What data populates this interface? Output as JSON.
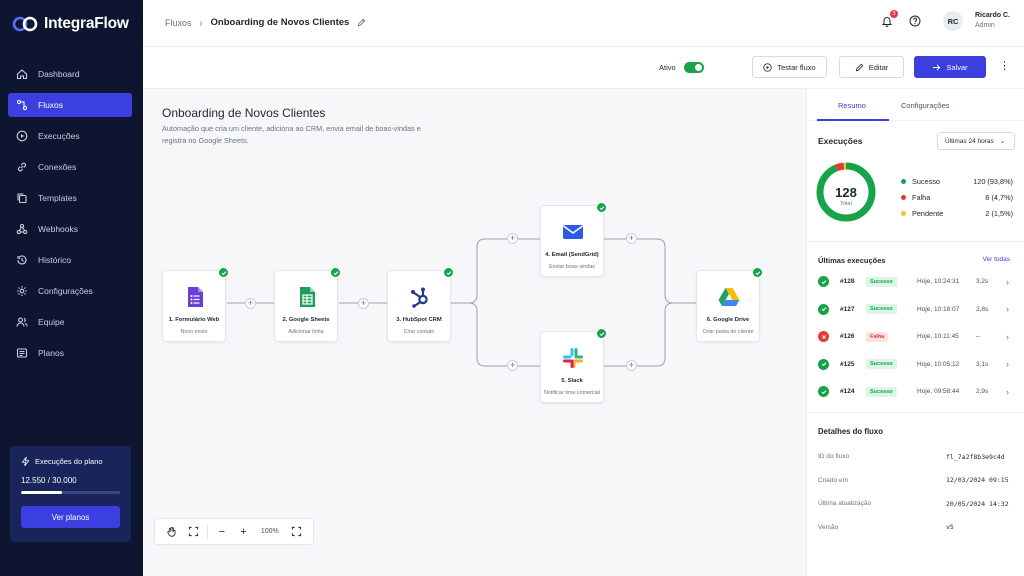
{
  "app": {
    "name": "IntegraFlow",
    "colors": {
      "accent": "#3b3fe0",
      "sidebar": "#0d1530",
      "success": "#16a34a",
      "failure": "#e23b3b",
      "pending": "#f2c230"
    }
  },
  "sidebar": {
    "items": [
      {
        "label": "Dashboard",
        "icon": "home-icon",
        "active": false
      },
      {
        "label": "Fluxos",
        "icon": "flow-icon",
        "active": true
      },
      {
        "label": "Execuções",
        "icon": "play-circle-icon",
        "active": false
      },
      {
        "label": "Conexões",
        "icon": "link-icon",
        "active": false
      },
      {
        "label": "Templates",
        "icon": "copy-icon",
        "active": false
      },
      {
        "label": "Webhooks",
        "icon": "webhook-icon",
        "active": false
      },
      {
        "label": "Histórico",
        "icon": "history-icon",
        "active": false
      },
      {
        "label": "Configurações",
        "icon": "gear-icon",
        "active": false
      },
      {
        "label": "Equipe",
        "icon": "users-icon",
        "active": false
      },
      {
        "label": "Planos",
        "icon": "plans-icon",
        "active": false
      }
    ],
    "plan": {
      "title": "Execuções do plano",
      "count": "12.550 / 30.000",
      "usage_fraction": 0.418,
      "button": "Ver planos"
    }
  },
  "header": {
    "breadcrumb_root": "Fluxos",
    "breadcrumb_current": "Onboarding de Novos Clientes",
    "notification_count": "3",
    "user_initials": "RC",
    "user_name": "Ricardo C.",
    "user_role": "Admin"
  },
  "toolbar": {
    "active_label": "Ativo",
    "active_on": true,
    "test_label": "Testar fluxo",
    "edit_label": "Editar",
    "save_label": "Salvar"
  },
  "canvas": {
    "title": "Onboarding de Novos Clientes",
    "description": "Automação que cria um cliente, adiciona ao CRM, envia email de boas-vindas e registra no Google Sheets.",
    "zoom": "100%",
    "nodes": [
      {
        "title": "1. Formulário Web",
        "subtitle": "Novo envio",
        "icon": "google-forms-icon"
      },
      {
        "title": "2. Google Sheets",
        "subtitle": "Adicionar linha",
        "icon": "google-sheets-icon"
      },
      {
        "title": "3. HubSpot CRM",
        "subtitle": "Criar contato",
        "icon": "hubspot-icon"
      },
      {
        "title": "4. Email (SendGrid)",
        "subtitle": "Enviar boas-vindas",
        "icon": "email-icon"
      },
      {
        "title": "5. Slack",
        "subtitle": "Notificar time comercial",
        "icon": "slack-icon"
      },
      {
        "title": "6. Google Drive",
        "subtitle": "Criar pasta do cliente",
        "icon": "google-drive-icon"
      }
    ]
  },
  "panel": {
    "tabs": [
      "Resumo",
      "Configurações"
    ],
    "executions_title": "Execuções",
    "period": "Últimas 24 horas",
    "total": "128",
    "total_label": "Total",
    "legend": [
      {
        "label": "Sucesso",
        "value": "120 (93,8%)",
        "color": "#16a34a",
        "fraction": 0.938
      },
      {
        "label": "Falha",
        "value": "6 (4,7%)",
        "color": "#e23b3b",
        "fraction": 0.047
      },
      {
        "label": "Pendente",
        "value": "2 (1,5%)",
        "color": "#f2c230",
        "fraction": 0.015
      }
    ],
    "recent_title": "Últimas execuções",
    "see_all": "Ver todas",
    "recent": [
      {
        "id": "#128",
        "status": "Sucesso",
        "ok": true,
        "time": "Hoje, 10:24:31",
        "duration": "3,2s"
      },
      {
        "id": "#127",
        "status": "Sucesso",
        "ok": true,
        "time": "Hoje, 10:18:07",
        "duration": "2,8s"
      },
      {
        "id": "#126",
        "status": "Falha",
        "ok": false,
        "time": "Hoje, 10:11:45",
        "duration": "–"
      },
      {
        "id": "#125",
        "status": "Sucesso",
        "ok": true,
        "time": "Hoje, 10:05:12",
        "duration": "3,1s"
      },
      {
        "id": "#124",
        "status": "Sucesso",
        "ok": true,
        "time": "Hoje, 09:58:44",
        "duration": "2,9s"
      }
    ],
    "details_title": "Detalhes do fluxo",
    "details": [
      {
        "label": "ID do fluxo",
        "value": "fl_7a2f8b3e9c4d"
      },
      {
        "label": "Criado em",
        "value": "12/03/2024 09:15"
      },
      {
        "label": "Última atualização",
        "value": "20/05/2024 14:32"
      },
      {
        "label": "Versão",
        "value": "v5"
      }
    ]
  }
}
